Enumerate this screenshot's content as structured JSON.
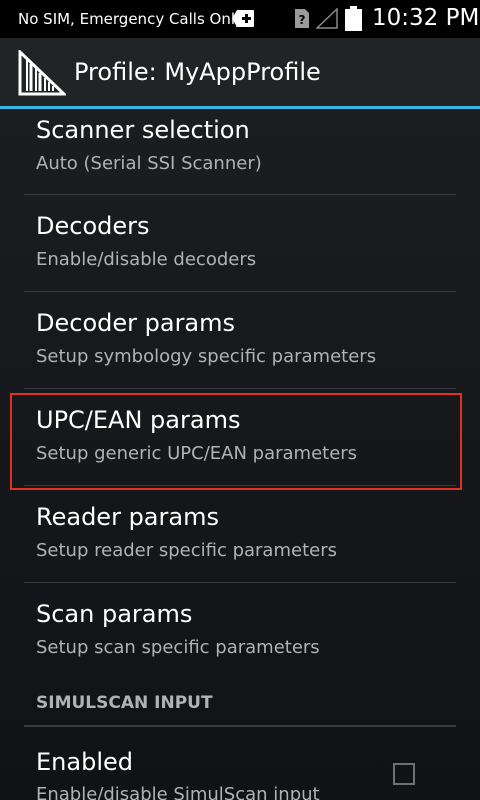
{
  "status_bar": {
    "carrier_text": "No SIM, Emergency Calls Only",
    "time": "10:32 PM",
    "icons": [
      "notification-plus-icon",
      "no-sim-icon",
      "signal-icon",
      "battery-icon"
    ]
  },
  "action_bar": {
    "title": "Profile: MyAppProfile",
    "icon": "barcode-app-icon",
    "accent_color": "#33b5e5"
  },
  "preferences": [
    {
      "title": "Scanner selection",
      "summary": "Auto (Serial SSI Scanner)"
    },
    {
      "title": "Decoders",
      "summary": "Enable/disable decoders"
    },
    {
      "title": "Decoder params",
      "summary": "Setup symbology specific parameters"
    },
    {
      "title": "UPC/EAN params",
      "summary": "Setup generic UPC/EAN parameters",
      "highlighted": true
    },
    {
      "title": "Reader params",
      "summary": "Setup reader specific parameters"
    },
    {
      "title": "Scan params",
      "summary": "Setup scan specific parameters"
    }
  ],
  "simulscan": {
    "section_header": "SIMULSCAN INPUT",
    "enabled_title": "Enabled",
    "enabled_summary": "Enable/disable SimulScan input",
    "checked": false
  },
  "highlight_color": "#e0301e"
}
